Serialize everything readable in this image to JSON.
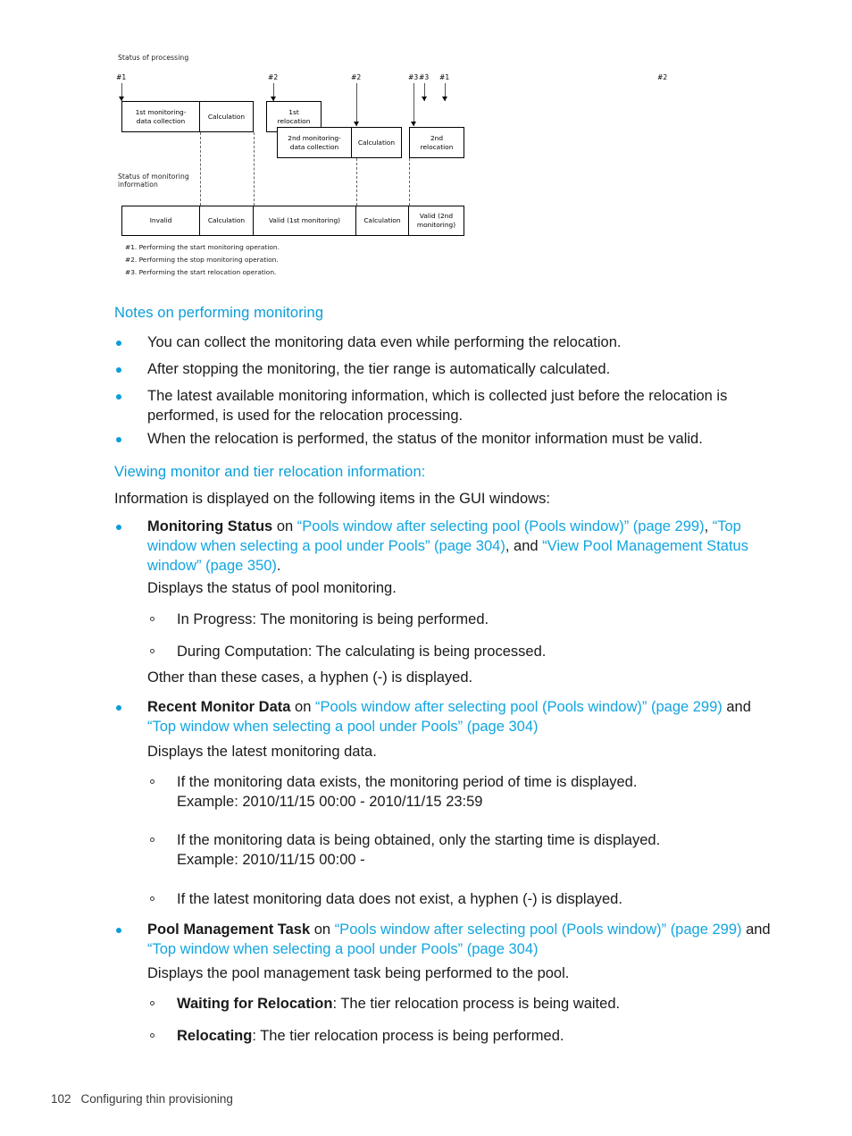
{
  "figure": {
    "caption_processing": "Status of processing",
    "caption_monitoring": "Status of monitoring\ninformation",
    "markers": [
      "#1",
      "#2",
      "#3",
      "#1",
      "#2",
      "#3"
    ],
    "row1_boxes": [
      "1st monitoring-\ndata collection",
      "Calculation",
      "1st\nrelocation"
    ],
    "row2_boxes": [
      "2nd monitoring-\ndata collection",
      "Calculation",
      "2nd\nrelocation"
    ],
    "status_cells": [
      "Invalid",
      "Calculation",
      "Valid (1st monitoring)",
      "Calculation",
      "Valid (2nd\nmonitoring)"
    ],
    "notes": [
      "#1. Performing the start monitoring operation.",
      "#2. Performing the stop monitoring operation.",
      "#3. Performing the start relocation operation."
    ]
  },
  "sections": {
    "notes_heading": "Notes on performing monitoring",
    "notes_bullets": [
      "You can collect the monitoring data even while performing the relocation.",
      "After stopping the monitoring, the tier range is automatically calculated.",
      "The latest available monitoring information, which is collected just before the relocation is\nperformed, is used for the relocation processing.",
      "When the relocation is performed, the status of the monitor information must be valid."
    ],
    "viewing_heading": "Viewing monitor and tier relocation information:",
    "viewing_intro": "Information is displayed on the following items in the GUI windows:",
    "monitoring_status": {
      "term": "Monitoring Status",
      "on": " on ",
      "link1": "“Pools window after selecting pool (Pools window)” (page 299)",
      "sep1": ", ",
      "link2": "“Top window when selecting a pool under Pools” (page 304)",
      "sep2": ", and ",
      "link3": "“View Pool Management Status window” (page 350)",
      "end": ".",
      "desc": "Displays the status of pool monitoring.",
      "subitems": [
        "In Progress: The monitoring is being performed.",
        "During Computation: The calculating is being processed."
      ],
      "trailer": "Other than these cases, a hyphen (-) is displayed."
    },
    "recent_monitor_data": {
      "term": "Recent Monitor Data",
      "on": " on ",
      "link1": "“Pools window after selecting pool (Pools window)” (page 299)",
      "sep1": " and ",
      "link2": "“Top window when selecting a pool under Pools” (page 304)",
      "desc": "Displays the latest monitoring data.",
      "subitems": [
        "If the monitoring data exists, the monitoring period of time is displayed.\nExample: 2010/11/15 00:00 - 2010/11/15 23:59",
        "If the monitoring data is being obtained, only the starting time is displayed.\nExample: 2010/11/15 00:00 -",
        "If the latest monitoring data does not exist, a hyphen (-) is displayed."
      ]
    },
    "pool_management_task": {
      "term": "Pool Management Task",
      "on": " on ",
      "link1": "“Pools window after selecting pool (Pools window)” (page 299)",
      "sep1": " and ",
      "link2": "“Top window when selecting a pool under Pools” (page 304)",
      "desc": "Displays the pool management task being performed to the pool.",
      "subitems": [
        {
          "term": "Waiting for Relocation",
          "rest": ": The tier relocation process is being waited."
        },
        {
          "term": "Relocating",
          "rest": ": The tier relocation process is being performed."
        }
      ]
    }
  },
  "footer": {
    "page_number": "102",
    "chapter": "Configuring thin provisioning"
  },
  "colors": {
    "heading_blue": "#0b9dd9",
    "link_blue": "#12a5e0",
    "body_text": "#1a1a1a"
  }
}
